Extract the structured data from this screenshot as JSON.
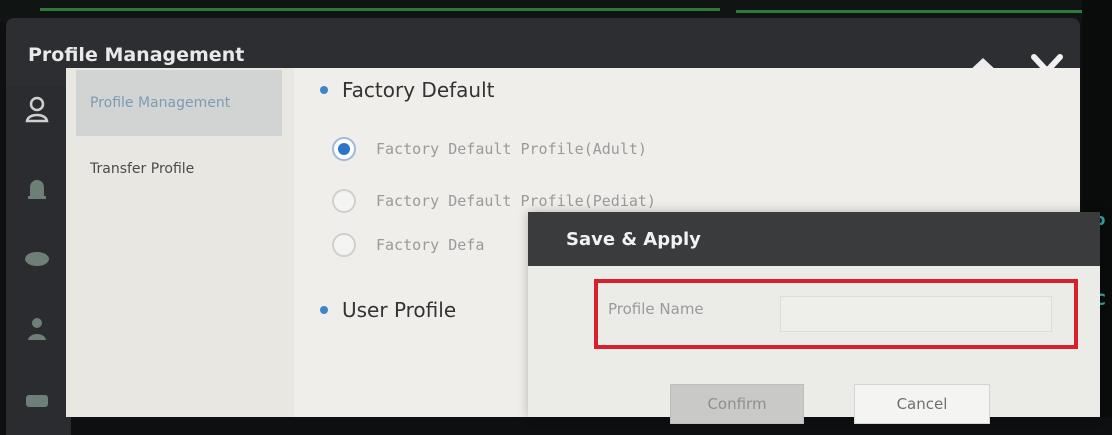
{
  "window": {
    "title": "Profile Management",
    "home_icon": "home-icon",
    "close_icon": "close-icon"
  },
  "left_nav": {
    "icons": [
      "user-icon",
      "alarm-bell-icon",
      "monitor-icon",
      "person-settings-icon",
      "keyboard-icon"
    ]
  },
  "side_menu": {
    "items": [
      {
        "label": "Profile Management",
        "active": true
      },
      {
        "label": "Transfer Profile",
        "active": false
      }
    ]
  },
  "content": {
    "factory_default": {
      "heading": "Factory Default",
      "options": [
        {
          "label": "Factory Default Profile(Adult)",
          "selected": true
        },
        {
          "label": "Factory Default Profile(Pediat)",
          "selected": false
        },
        {
          "label": "Factory Defa",
          "selected": false
        }
      ]
    },
    "user_profile": {
      "heading": "User Profile"
    }
  },
  "dialog": {
    "title": "Save & Apply",
    "field_label": "Profile Name",
    "field_value": "",
    "confirm_label": "Confirm",
    "confirm_enabled": false,
    "cancel_label": "Cancel",
    "highlight_color": "#d8202a"
  },
  "accent_color": "#2b74c8",
  "bg_glyphs": [
    "p",
    "C"
  ]
}
